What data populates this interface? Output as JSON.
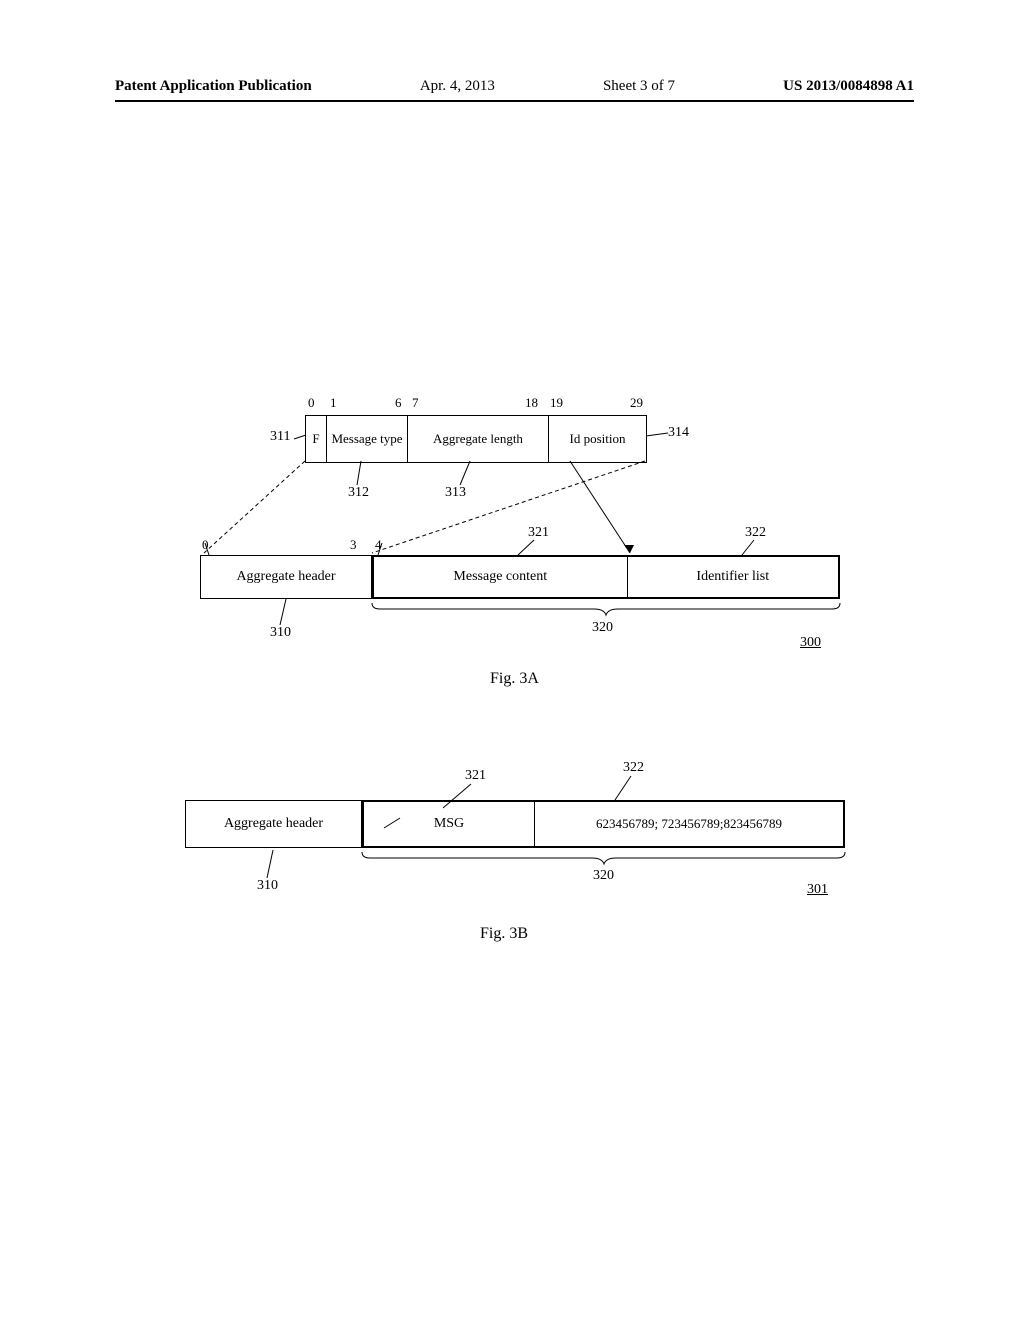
{
  "header": {
    "publication": "Patent Application Publication",
    "date": "Apr. 4, 2013",
    "sheet": "Sheet 3 of 7",
    "pubno": "US 2013/0084898 A1"
  },
  "fig3a": {
    "bits": {
      "b0": "0",
      "b1": "1",
      "b6": "6",
      "b7": "7",
      "b18": "18",
      "b19": "19",
      "b29": "29"
    },
    "f": "F",
    "msgtype": "Message type",
    "agglen": "Aggregate length",
    "idpos": "Id position",
    "ref311": "311",
    "ref312": "312",
    "ref313": "313",
    "ref314": "314",
    "bodybits": {
      "b0": "0",
      "b3": "3",
      "b4": "4"
    },
    "aggheader": "Aggregate header",
    "msgcontent": "Message content",
    "idlist": "Identifier list",
    "ref310": "310",
    "ref320": "320",
    "ref321": "321",
    "ref322": "322",
    "ref300": "300",
    "caption": "Fig. 3A"
  },
  "fig3b": {
    "ref321": "321",
    "ref322": "322",
    "aggheader": "Aggregate header",
    "msg": "MSG",
    "ids": "623456789; 723456789;823456789",
    "ref310": "310",
    "ref320": "320",
    "ref301": "301",
    "caption": "Fig. 3B"
  }
}
